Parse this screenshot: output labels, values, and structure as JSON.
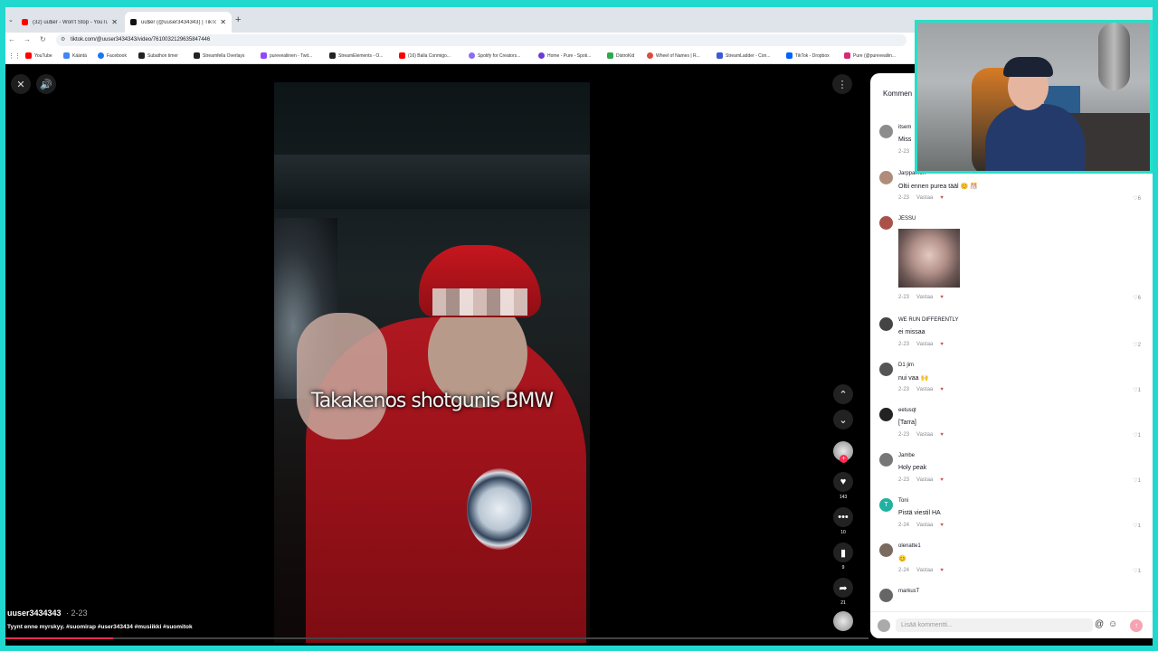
{
  "browser": {
    "tabs": [
      {
        "label": "(32) uu$er - Won't Stop - YouTu...",
        "active": false,
        "color": "#ff0000"
      },
      {
        "label": "uu$er (@uuser3434343) | TikTo...",
        "active": true,
        "color": "#111111"
      }
    ],
    "url": "tiktok.com/@uuser3434343/video/7610032129635847446",
    "bookmarks": [
      {
        "label": "YouTube",
        "color": "#ff0000"
      },
      {
        "label": "Kääntä",
        "color": "#4285f4"
      },
      {
        "label": "Facebook",
        "color": "#1877f2"
      },
      {
        "label": "Subathon timer",
        "color": "#222222"
      },
      {
        "label": "Streamfella Overlays",
        "color": "#222222"
      },
      {
        "label": "purevealiinen - Twit...",
        "color": "#9146ff"
      },
      {
        "label": "StreamElements - O...",
        "color": "#222222"
      },
      {
        "label": "(16) Balla Conmigo...",
        "color": "#ff0000"
      },
      {
        "label": "Spotify for Creators...",
        "color": "#8b6df5"
      },
      {
        "label": "Home - Pure - Spoti...",
        "color": "#6a3ad9"
      },
      {
        "label": "DistroKid",
        "color": "#2fa84f"
      },
      {
        "label": "Wheel of Names | R...",
        "color": "#e04a3f"
      },
      {
        "label": "StreamLadder - Con...",
        "color": "#3c57d8"
      },
      {
        "label": "TikTok - Dropbox",
        "color": "#0061fe"
      },
      {
        "label": "Pure (@purevealiin...",
        "color": "#d62976"
      }
    ]
  },
  "video": {
    "caption": "Takakenos shotgunis BMW",
    "author": "uuser3434343",
    "date": "2-23",
    "description": "Tyynt enne myrskyy. #suomirap #user343434 #musiikki #suomitok",
    "progress_percent": 12.5
  },
  "actions": {
    "likes": "143",
    "comments": "10",
    "saves": "9",
    "shares": "21"
  },
  "comments_panel": {
    "title": "Kommen",
    "input_placeholder": "Lisää kommentti...",
    "reply_label": "Vastaa",
    "comments": [
      {
        "user": "itsem",
        "text": "Miss",
        "date": "2-23",
        "likes": "",
        "avatar": "#8c8c8c",
        "initial": ""
      },
      {
        "user": "Jarppamoh",
        "text": "Oltii ennen purea tääl 😊 🎊",
        "date": "2-23",
        "likes": "6",
        "avatar": "#b08d7a",
        "initial": ""
      },
      {
        "user": "JESSU",
        "text": "",
        "date": "2-23",
        "likes": "6",
        "avatar": "#a9524a",
        "initial": ""
      },
      {
        "user": "WE RUN DIFFERENTLY",
        "text": "ei missaa",
        "date": "2-23",
        "likes": "2",
        "avatar": "#444444",
        "initial": ""
      },
      {
        "user": "D1 jim",
        "text": "nui vaa 🙌",
        "date": "2-23",
        "likes": "1",
        "avatar": "#555555",
        "initial": ""
      },
      {
        "user": "eetusqt",
        "text": "[Tarra]",
        "date": "2-23",
        "likes": "1",
        "avatar": "#222222",
        "initial": ""
      },
      {
        "user": "Jambe",
        "text": "Holy peak",
        "date": "2-23",
        "likes": "1",
        "avatar": "#777777",
        "initial": ""
      },
      {
        "user": "Toni",
        "text": "Pistä viestil HA",
        "date": "2-24",
        "likes": "1",
        "avatar": "#20b2a0",
        "initial": "T"
      },
      {
        "user": "olenatte1",
        "text": "😊",
        "date": "2-24",
        "likes": "1",
        "avatar": "#7a6a60",
        "initial": ""
      },
      {
        "user": "markusT",
        "text": "",
        "date": "",
        "likes": "",
        "avatar": "#666666",
        "initial": ""
      }
    ]
  }
}
